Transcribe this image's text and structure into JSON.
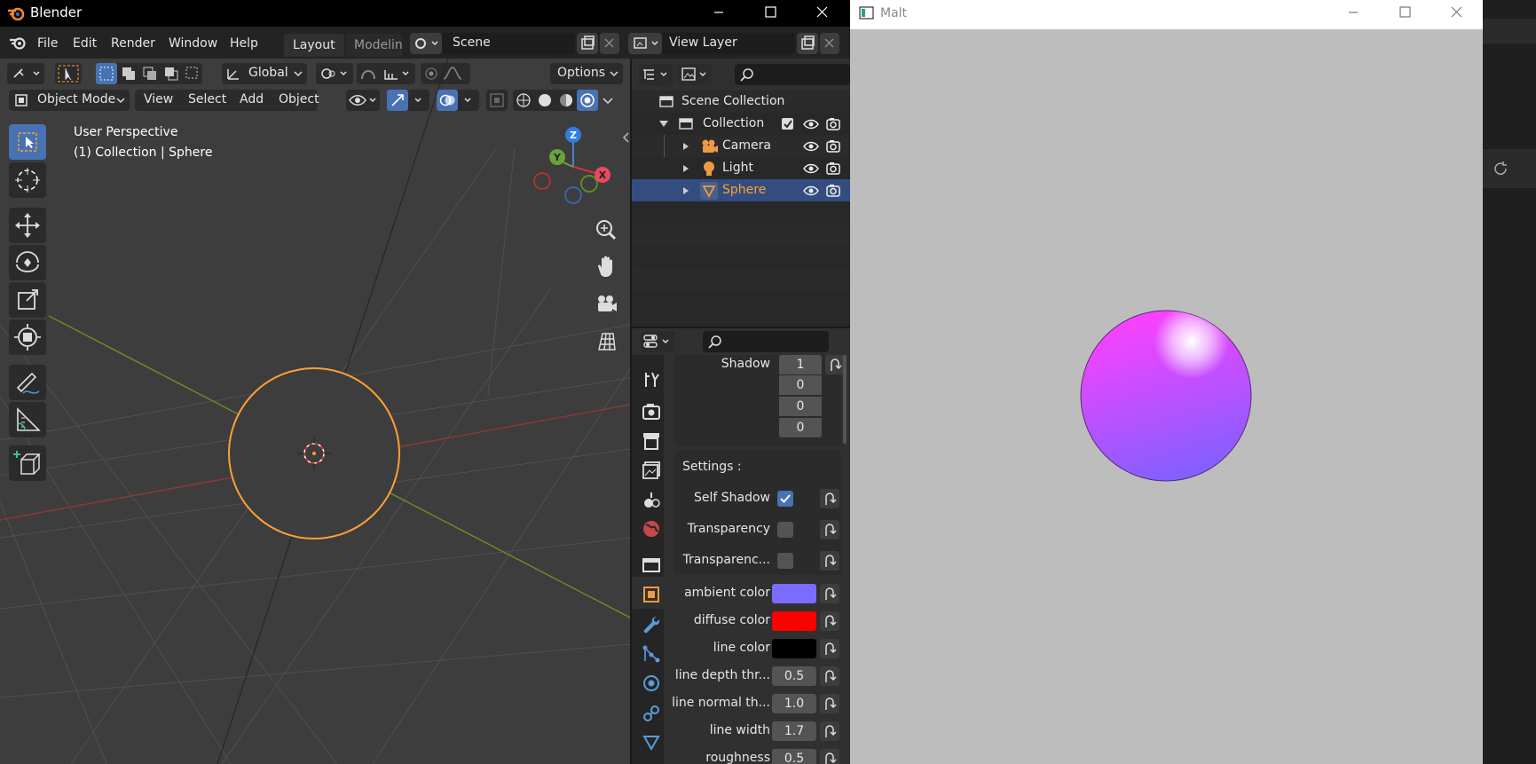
{
  "blender": {
    "title": "Blender",
    "menu": [
      "File",
      "Edit",
      "Render",
      "Window",
      "Help"
    ],
    "workspaces": [
      "Layout",
      "Modeling"
    ],
    "scene": "Scene",
    "view_layer": "View Layer",
    "toolbar": {
      "orientation": "Global",
      "options": "Options",
      "mode": "Object Mode",
      "view": "View",
      "select": "Select",
      "add": "Add",
      "object": "Object"
    },
    "viewport": {
      "overlay_line1": "User Perspective",
      "overlay_line2": "(1) Collection | Sphere",
      "gizmo": {
        "z": "Z",
        "y": "Y",
        "x": "X"
      }
    },
    "outliner": {
      "items": [
        {
          "label": "Scene Collection"
        },
        {
          "label": "Collection"
        },
        {
          "label": "Camera"
        },
        {
          "label": "Light"
        },
        {
          "label": "Sphere"
        }
      ]
    },
    "properties": {
      "shadow_label": "Shadow",
      "shadow_values": [
        "1",
        "0",
        "0",
        "0"
      ],
      "settings_label": "Settings :",
      "self_shadow": {
        "label": "Self Shadow",
        "checked": true
      },
      "transparency": {
        "label": "Transparency",
        "checked": false
      },
      "transparency2": {
        "label": "Transparenc...",
        "checked": false
      },
      "ambient_color": {
        "label": "ambient color",
        "value": "#7b6cff"
      },
      "diffuse_color": {
        "label": "diffuse color",
        "value": "#ff0000"
      },
      "line_color": {
        "label": "line color",
        "value": "#000000"
      },
      "line_depth": {
        "label": "line depth thr...",
        "value": "0.5"
      },
      "line_normal": {
        "label": "line normal th...",
        "value": "1.0"
      },
      "line_width": {
        "label": "line width",
        "value": "1.7"
      },
      "roughness": {
        "label": "roughness",
        "value": "0.5"
      }
    }
  },
  "malt": {
    "title": "Malt"
  },
  "colors": {
    "accent": "#4772b3",
    "selected_object": "#ffa033",
    "sphere_top": "#ff40ff",
    "sphere_bottom": "#8060ff"
  }
}
